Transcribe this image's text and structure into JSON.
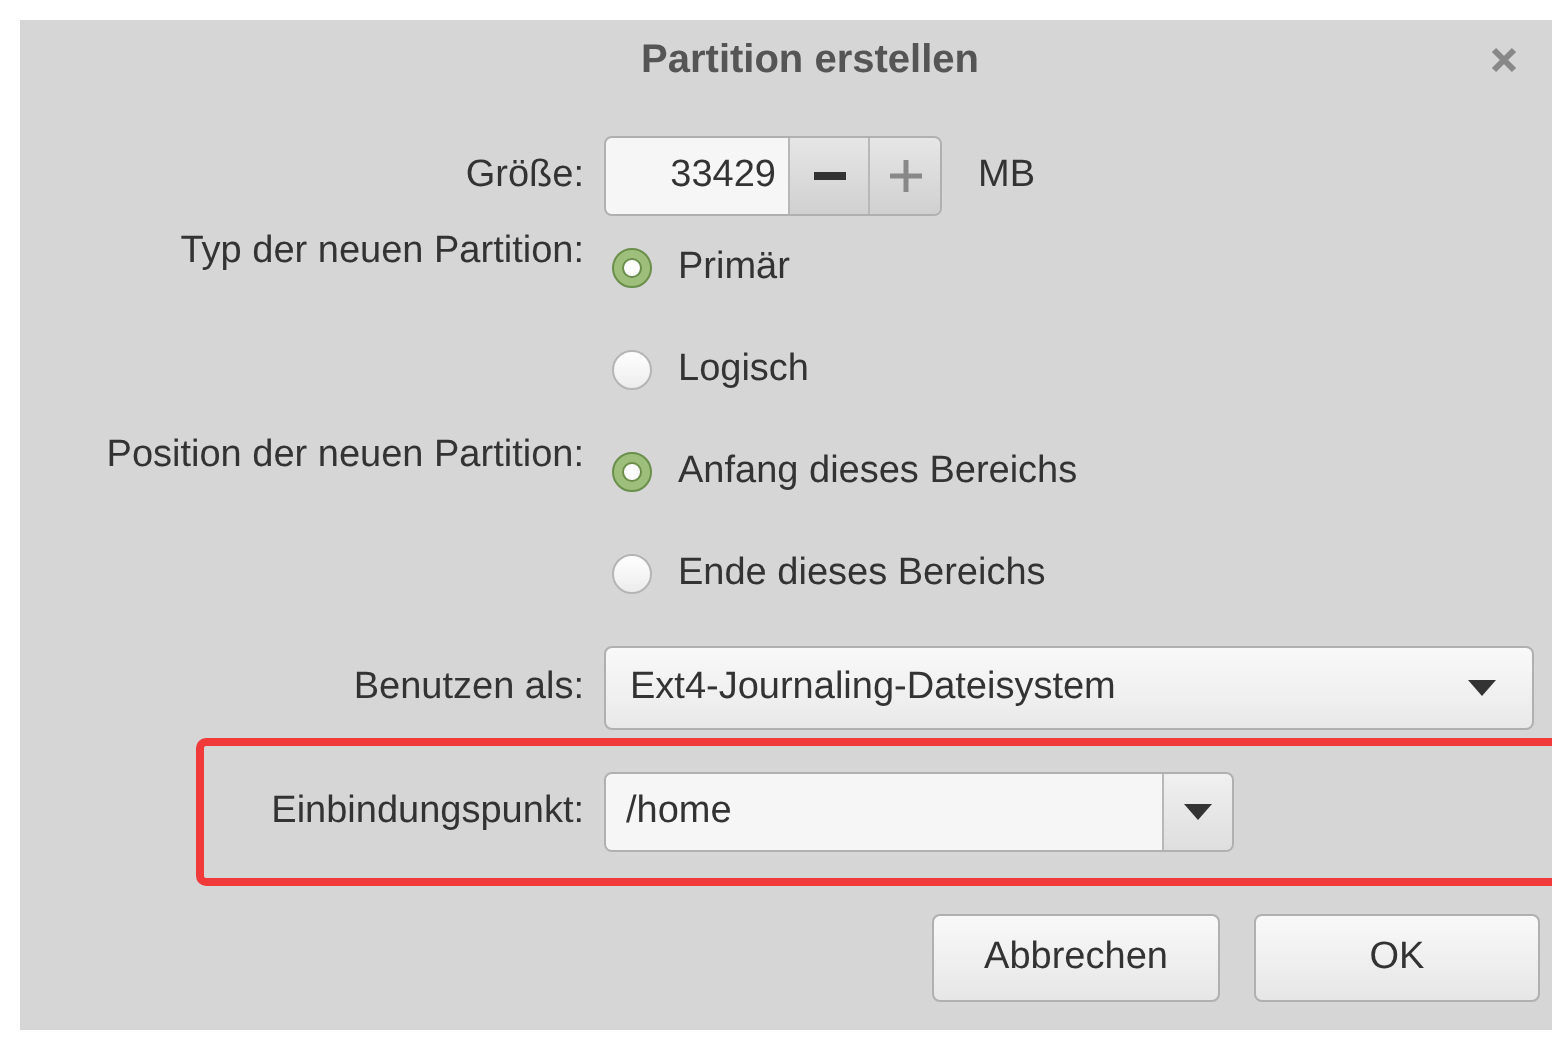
{
  "window": {
    "title": "Partition erstellen"
  },
  "size": {
    "label": "Größe:",
    "value": "33429",
    "unit": "MB"
  },
  "type": {
    "label": "Typ der neuen Partition:",
    "options": [
      {
        "label": "Primär",
        "selected": true
      },
      {
        "label": "Logisch",
        "selected": false
      }
    ]
  },
  "position": {
    "label": "Position der neuen Partition:",
    "options": [
      {
        "label": "Anfang dieses Bereichs",
        "selected": true
      },
      {
        "label": "Ende dieses Bereichs",
        "selected": false
      }
    ]
  },
  "use_as": {
    "label": "Benutzen als:",
    "value": "Ext4-Journaling-Dateisystem"
  },
  "mount_point": {
    "label": "Einbindungspunkt:",
    "value": "/home",
    "highlighted": true
  },
  "buttons": [
    {
      "label": "Abbrechen",
      "kind": "cancel"
    },
    {
      "label": "OK",
      "kind": "ok"
    }
  ]
}
